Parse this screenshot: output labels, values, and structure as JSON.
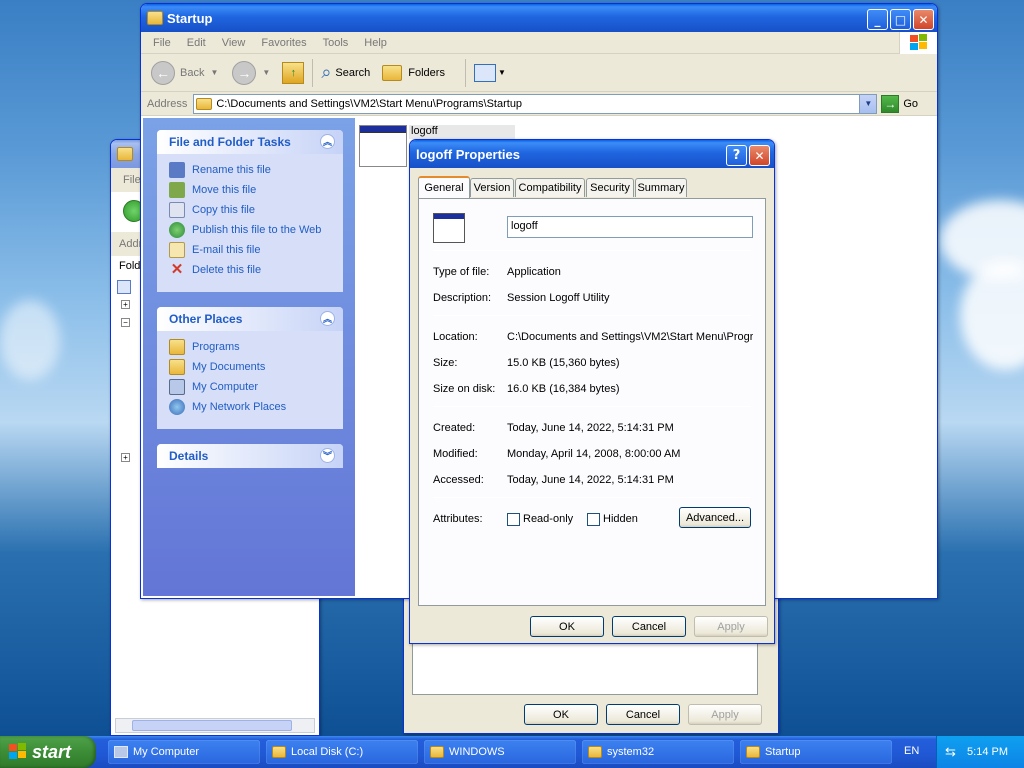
{
  "explorer": {
    "title": "Startup",
    "menu": [
      "File",
      "Edit",
      "View",
      "Favorites",
      "Tools",
      "Help"
    ],
    "toolbar": {
      "back": "Back",
      "search": "Search",
      "folders": "Folders"
    },
    "address": {
      "label": "Address",
      "value": "C:\\Documents and Settings\\VM2\\Start Menu\\Programs\\Startup",
      "go": "Go"
    },
    "file_tasks": {
      "title": "File and Folder Tasks",
      "items": [
        "Rename this file",
        "Move this file",
        "Copy this file",
        "Publish this file to the Web",
        "E-mail this file",
        "Delete this file"
      ]
    },
    "other_places": {
      "title": "Other Places",
      "items": [
        "Programs",
        "My Documents",
        "My Computer",
        "My Network Places"
      ]
    },
    "details": {
      "title": "Details"
    },
    "file_label": "logoff"
  },
  "back_window": {
    "menu_first": "File",
    "address_label": "Addr",
    "folders_label": "Fold"
  },
  "dialog": {
    "title": "logoff Properties",
    "tabs": [
      "General",
      "Version",
      "Compatibility",
      "Security",
      "Summary"
    ],
    "name": "logoff",
    "rows": [
      {
        "label": "Type of file:",
        "value": "Application"
      },
      {
        "label": "Description:",
        "value": "Session Logoff Utility"
      },
      {
        "label": "Location:",
        "value": "C:\\Documents and Settings\\VM2\\Start Menu\\Progr"
      },
      {
        "label": "Size:",
        "value": "15.0 KB (15,360 bytes)"
      },
      {
        "label": "Size on disk:",
        "value": "16.0 KB (16,384 bytes)"
      },
      {
        "label": "Created:",
        "value": "Today, June 14, 2022, 5:14:31 PM"
      },
      {
        "label": "Modified:",
        "value": "Monday, April 14, 2008, 8:00:00 AM"
      },
      {
        "label": "Accessed:",
        "value": "Today, June 14, 2022, 5:14:31 PM"
      }
    ],
    "attributes_label": "Attributes:",
    "readonly": "Read-only",
    "hidden": "Hidden",
    "advanced": "Advanced...",
    "ok": "OK",
    "cancel": "Cancel",
    "apply": "Apply"
  },
  "behind_dialog": {
    "ok": "OK",
    "cancel": "Cancel",
    "apply": "Apply"
  },
  "taskbar": {
    "start": "start",
    "items": [
      "My Computer",
      "Local Disk (C:)",
      "WINDOWS",
      "system32",
      "Startup"
    ],
    "lang": "EN",
    "time": "5:14 PM"
  }
}
